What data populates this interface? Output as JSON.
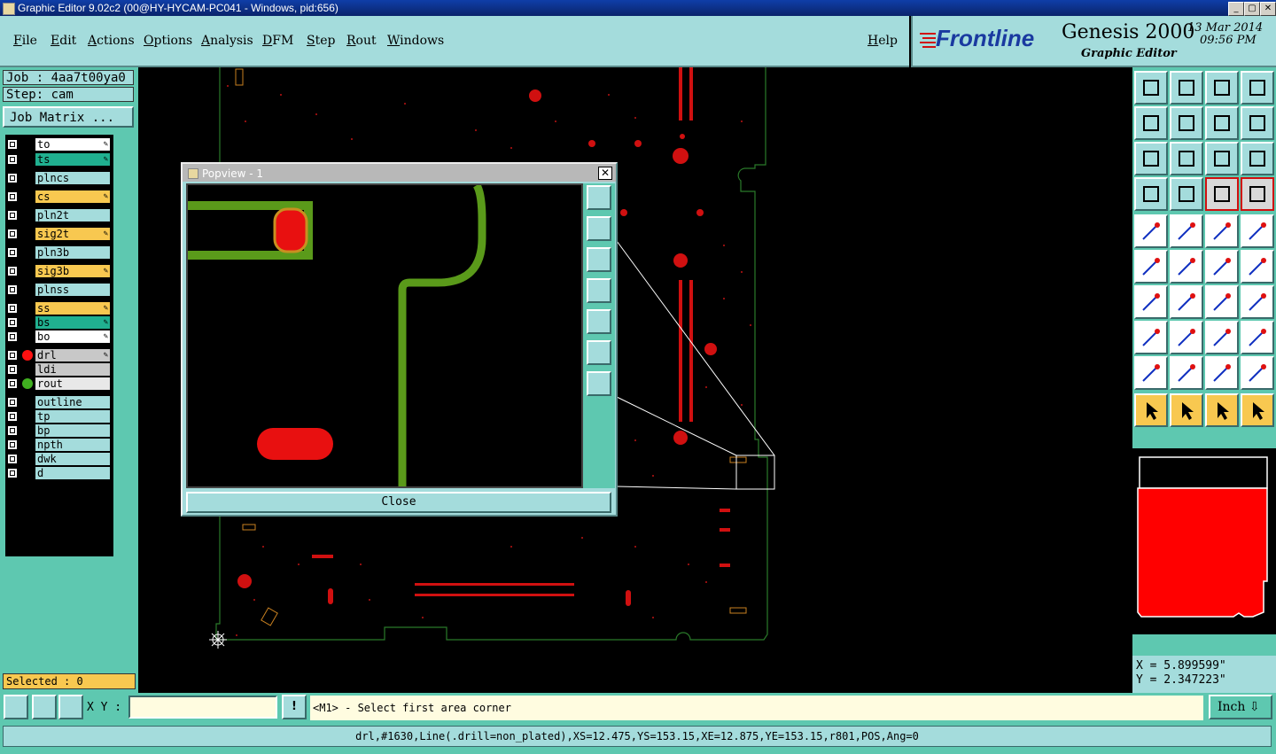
{
  "window": {
    "title": "Graphic Editor 9.02c2 (00@HY-HYCAM-PC041 - Windows, pid:656)",
    "controls": [
      "_",
      "▢",
      "✕"
    ]
  },
  "menu": [
    "File",
    "Edit",
    "Actions",
    "Options",
    "Analysis",
    "DFM",
    "Step",
    "Rout",
    "Windows"
  ],
  "help_label": "Help",
  "brand": {
    "logo": "Frontline",
    "product": "Genesis 2000",
    "subtitle": "Graphic Editor",
    "date": "13 Mar 2014",
    "time": "09:56 PM"
  },
  "job": {
    "job_label": "Job : 4aa7t00ya0",
    "step_label": "Step: cam",
    "matrix_button": "Job Matrix ..."
  },
  "layers": [
    {
      "name": "to",
      "color": "#ffffff",
      "mark": true
    },
    {
      "name": "ts",
      "color": "#20b090",
      "mark": true
    },
    {
      "name": "plncs",
      "color": "#a4dcdc",
      "mark": false
    },
    {
      "name": "cs",
      "color": "#f8c850",
      "mark": true
    },
    {
      "name": "pln2t",
      "color": "#a4dcdc",
      "mark": false
    },
    {
      "name": "sig2t",
      "color": "#f8c850",
      "mark": true
    },
    {
      "name": "pln3b",
      "color": "#a4dcdc",
      "mark": false
    },
    {
      "name": "sig3b",
      "color": "#f8c850",
      "mark": true
    },
    {
      "name": "plnss",
      "color": "#a4dcdc",
      "mark": false
    },
    {
      "name": "ss",
      "color": "#f8c850",
      "mark": true
    },
    {
      "name": "bs",
      "color": "#20b090",
      "mark": true
    },
    {
      "name": "bo",
      "color": "#ffffff",
      "mark": true
    },
    {
      "name": "drl",
      "color": "#c8c8c8",
      "mark": true
    },
    {
      "name": "ldi",
      "color": "#c8c8c8",
      "mark": false
    },
    {
      "name": "rout",
      "color": "#e8e8e8",
      "mark": false
    },
    {
      "name": "outline",
      "color": "#a4dcdc",
      "mark": false
    },
    {
      "name": "tp",
      "color": "#a4dcdc",
      "mark": false
    },
    {
      "name": "bp",
      "color": "#a4dcdc",
      "mark": false
    },
    {
      "name": "npth",
      "color": "#a4dcdc",
      "mark": false
    },
    {
      "name": "dwk",
      "color": "#a4dcdc",
      "mark": false
    },
    {
      "name": "d",
      "color": "#a4dcdc",
      "mark": false
    }
  ],
  "selected_label": "Selected : 0",
  "popview": {
    "title": "Popview - 1",
    "close_label": "Close",
    "close_x": "✕"
  },
  "coords": {
    "x": "X =  5.899599\"",
    "y": "Y =  2.347223\""
  },
  "bottom": {
    "xy_label": "X Y :",
    "xy_value": "",
    "alert": "!",
    "prompt": "<M1> - Select first area corner",
    "units": "Inch ⇩"
  },
  "status": "drl,#1630,Line(.drill=non_plated),XS=12.475,YS=153.15,XE=12.875,YE=153.15,r801,POS,Ang=0",
  "colors": {
    "panel": "#5ec8b0",
    "light": "#a4dcdc",
    "pad": "#ff0000",
    "trace": "#5a9a1a",
    "accent": "#f8c850"
  }
}
